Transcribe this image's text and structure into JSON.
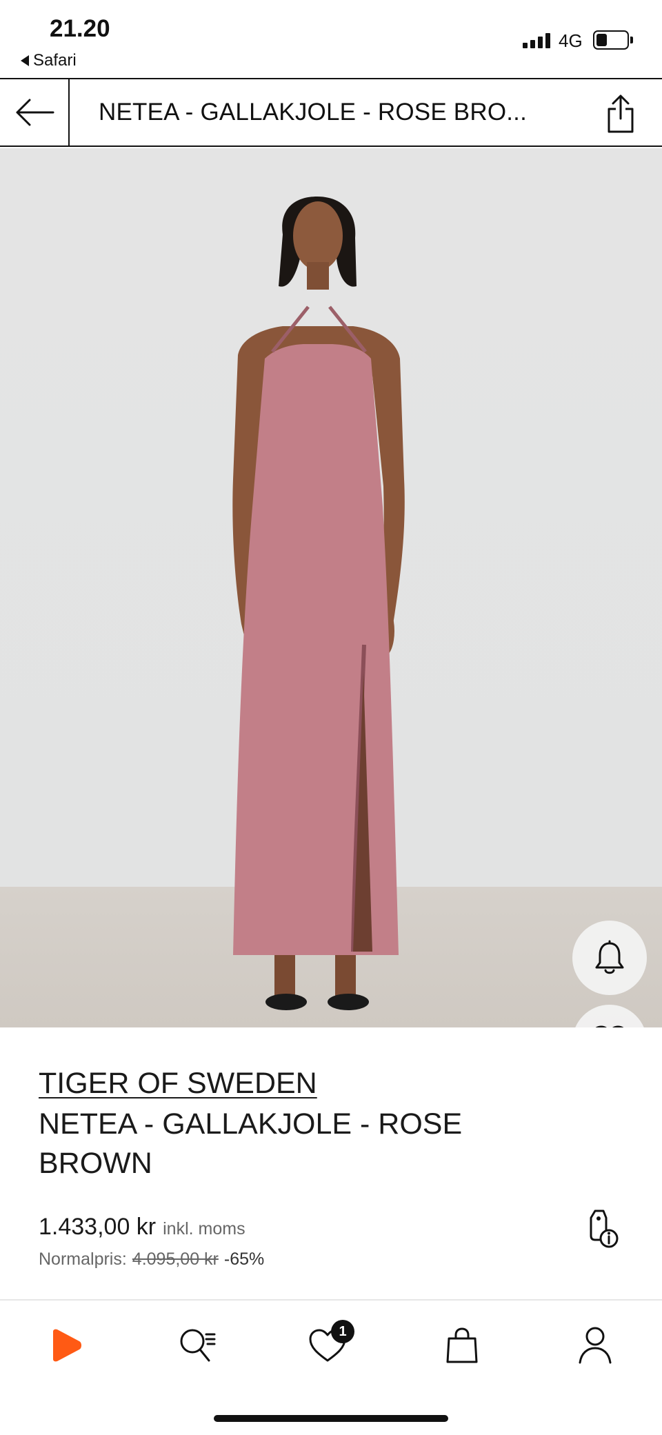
{
  "status_bar": {
    "time": "21.20",
    "back_app": "Safari",
    "network": "4G",
    "battery_level": 0.35
  },
  "nav": {
    "title": "NETEA - GALLAKJOLE - ROSE BRO..."
  },
  "product": {
    "brand": "TIGER OF SWEDEN",
    "name": "NETEA - GALLAKJOLE - ROSE BROWN",
    "price": "1.433,00 kr",
    "vat_note": "inkl. moms",
    "normal_label": "Normalpris:",
    "old_price": "4.095,00 kr",
    "discount": "-65%",
    "dress_color": "#c27f88"
  },
  "tabbar": {
    "wishlist_badge": "1",
    "brand_color": "#ff5a14"
  }
}
